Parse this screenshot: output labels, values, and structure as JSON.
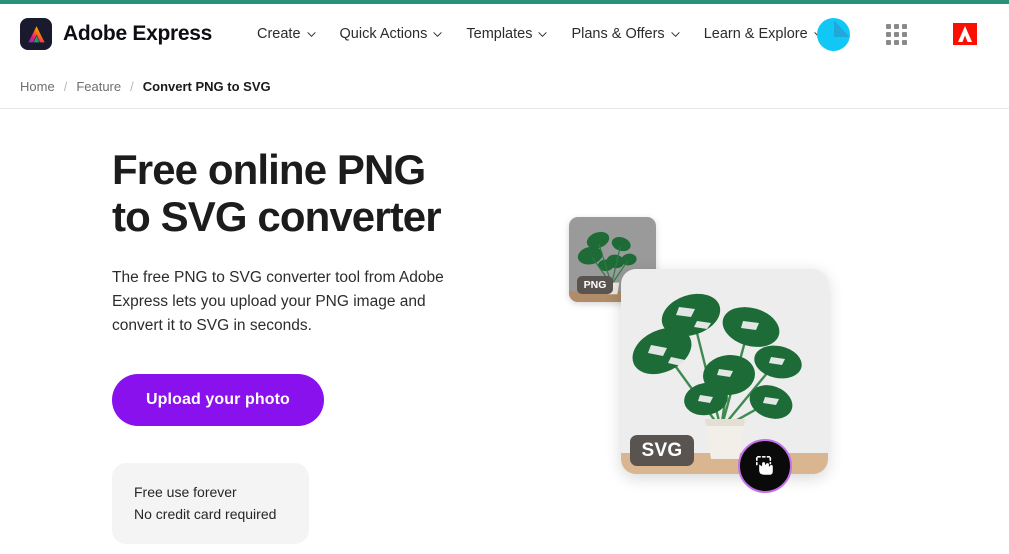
{
  "theme": {
    "accent_bar": "#2a9178",
    "cta_purple": "#8811ee",
    "adobe_red": "#fa0f00",
    "avatar_cyan": "#10c7f5",
    "badge_gray": "#5a5450",
    "freebox_gray": "#f4f4f4"
  },
  "header": {
    "brand_name": "Adobe Express",
    "brand_logo_icon": "adobe-express-logo-icon",
    "nav": [
      {
        "label": "Create",
        "icon": "chevron-down-icon"
      },
      {
        "label": "Quick Actions",
        "icon": "chevron-down-icon"
      },
      {
        "label": "Templates",
        "icon": "chevron-down-icon"
      },
      {
        "label": "Plans & Offers",
        "icon": "chevron-down-icon"
      },
      {
        "label": "Learn & Explore",
        "icon": "chevron-down-icon"
      }
    ],
    "avatar_icon": "user-avatar-icon",
    "appgrid_icon": "app-switcher-grid-icon",
    "adobe_icon": "adobe-logo-icon"
  },
  "breadcrumb": {
    "items": [
      {
        "label": "Home",
        "current": false
      },
      {
        "label": "Feature",
        "current": false
      },
      {
        "label": "Convert PNG to SVG",
        "current": true
      }
    ],
    "separator": "/"
  },
  "hero": {
    "title_line1": "Free online PNG",
    "title_line2": "to SVG converter",
    "description": "The free PNG to SVG converter tool from Adobe Express lets you upload your PNG image and convert it to SVG in seconds.",
    "cta_label": "Upload your photo",
    "free_note_line1": "Free use forever",
    "free_note_line2": "No credit card required"
  },
  "illustration": {
    "png_badge": "PNG",
    "svg_badge": "SVG",
    "fab_icon": "select-cursor-icon",
    "png_card_name": "png-source-card",
    "svg_card_name": "svg-result-card",
    "subject": "monstera-plant-image"
  }
}
